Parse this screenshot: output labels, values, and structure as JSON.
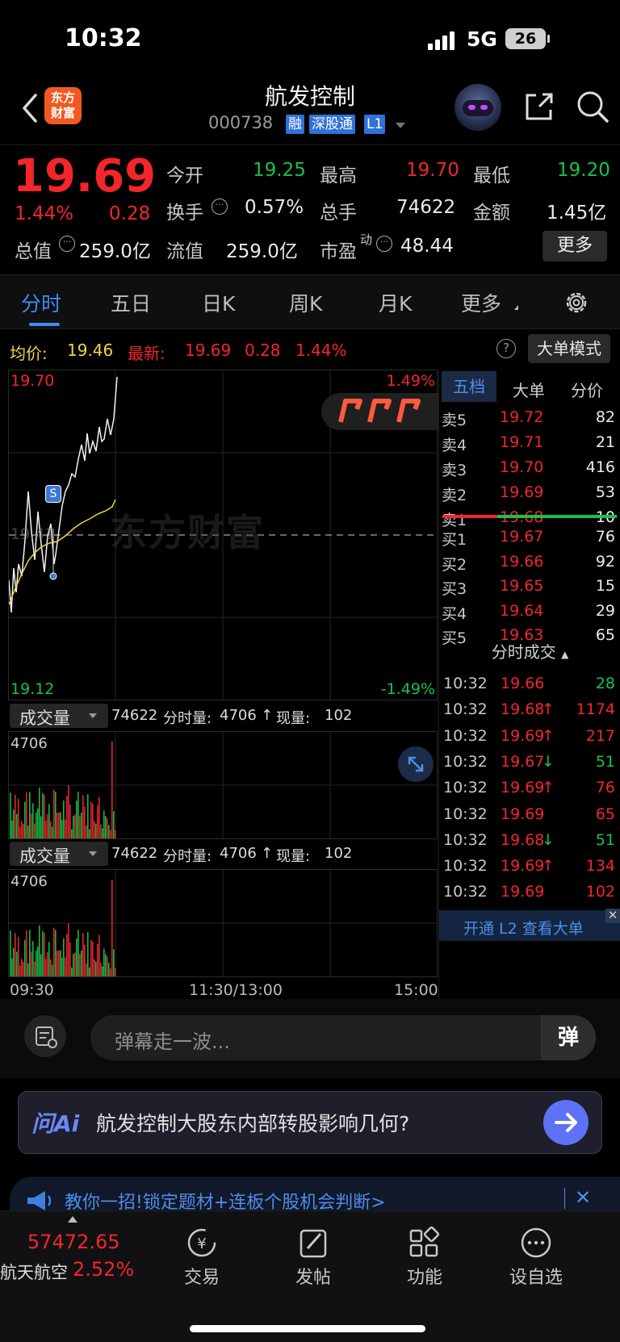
{
  "status": {
    "time": "10:32",
    "network": "5G",
    "battery": "26"
  },
  "header": {
    "title": "航发控制",
    "code": "000738",
    "tags": [
      "融",
      "深股通",
      "L1"
    ]
  },
  "quote": {
    "price": "19.69",
    "pct": "1.44%",
    "chg": "0.28",
    "cells": [
      {
        "label": "今开",
        "value": "19.25",
        "color": "green"
      },
      {
        "label": "最高",
        "value": "19.70",
        "color": "red"
      },
      {
        "label": "最低",
        "value": "19.20",
        "color": "green"
      },
      {
        "label": "换手",
        "value": "0.57%",
        "color": "white"
      },
      {
        "label": "总手",
        "value": "74622",
        "color": "white"
      },
      {
        "label": "金额",
        "value": "1.45亿",
        "color": "white"
      },
      {
        "label": "总值",
        "value": "259.0亿",
        "color": "white"
      },
      {
        "label": "流值",
        "value": "259.0亿",
        "color": "white"
      },
      {
        "label": "市盈",
        "sup": "动",
        "value": "48.44",
        "color": "white"
      }
    ],
    "more": "更多"
  },
  "tabs": [
    "分时",
    "五日",
    "日K",
    "周K",
    "月K",
    "更多"
  ],
  "info": {
    "avg_label": "均价:",
    "avg": "19.46",
    "latest_label": "最新:",
    "latest": "19.69",
    "chg": "0.28",
    "pct": "1.44%",
    "big_mode": "大单模式"
  },
  "chart": {
    "y_top": "19.70",
    "y_bot": "19.12",
    "y_mid": "19.41",
    "pct_top": "1.49%",
    "pct_bot": "-1.49%",
    "watermark": "东方财富",
    "marker": "S",
    "x_labels": [
      "09:30",
      "11:30/13:00",
      "15:00"
    ]
  },
  "volume": {
    "label": "成交量",
    "total": "74622",
    "period_label": "分时量:",
    "period": "4706",
    "arrow": "↑",
    "now_label": "现量:",
    "now": "102",
    "max": "4706"
  },
  "orderbook": {
    "tabs": [
      "五档",
      "大单",
      "分价"
    ],
    "asks": [
      {
        "l": "卖5",
        "p": "19.72",
        "v": "82"
      },
      {
        "l": "卖4",
        "p": "19.71",
        "v": "21"
      },
      {
        "l": "卖3",
        "p": "19.70",
        "v": "416"
      },
      {
        "l": "卖2",
        "p": "19.69",
        "v": "53"
      },
      {
        "l": "卖1",
        "p": "19.68",
        "v": "10"
      }
    ],
    "bids": [
      {
        "l": "买1",
        "p": "19.67",
        "v": "76"
      },
      {
        "l": "买2",
        "p": "19.66",
        "v": "92"
      },
      {
        "l": "买3",
        "p": "19.65",
        "v": "15"
      },
      {
        "l": "买4",
        "p": "19.64",
        "v": "29"
      },
      {
        "l": "买5",
        "p": "19.63",
        "v": "65"
      }
    ],
    "trades_title": "分时成交",
    "trades": [
      {
        "t": "10:32",
        "p": "19.66",
        "a": "",
        "v": "28",
        "vc": "green"
      },
      {
        "t": "10:32",
        "p": "19.68",
        "a": "↑",
        "v": "1174",
        "vc": "red"
      },
      {
        "t": "10:32",
        "p": "19.69",
        "a": "↑",
        "v": "217",
        "vc": "red"
      },
      {
        "t": "10:32",
        "p": "19.67",
        "a": "↓",
        "v": "51",
        "vc": "green"
      },
      {
        "t": "10:32",
        "p": "19.69",
        "a": "↑",
        "v": "76",
        "vc": "red"
      },
      {
        "t": "10:32",
        "p": "19.69",
        "a": "",
        "v": "65",
        "vc": "red"
      },
      {
        "t": "10:32",
        "p": "19.68",
        "a": "↓",
        "v": "51",
        "vc": "green"
      },
      {
        "t": "10:32",
        "p": "19.69",
        "a": "↑",
        "v": "134",
        "vc": "red"
      },
      {
        "t": "10:32",
        "p": "19.69",
        "a": "",
        "v": "102",
        "vc": "red"
      }
    ],
    "l2": "开通 L2 查看大单"
  },
  "danmu": {
    "placeholder": "弹幕走一波...",
    "send": "弹"
  },
  "ai": {
    "logo": "问Ai",
    "question": "航发控制大股东内部转股影响几何?"
  },
  "banner": {
    "text": "教你一招!锁定题材+连板个股机会判断>"
  },
  "bottom": {
    "index_value": "57472.65",
    "index_name": "航天航空",
    "index_pct": "2.52%",
    "items": [
      "交易",
      "发帖",
      "功能",
      "设自选"
    ]
  }
}
